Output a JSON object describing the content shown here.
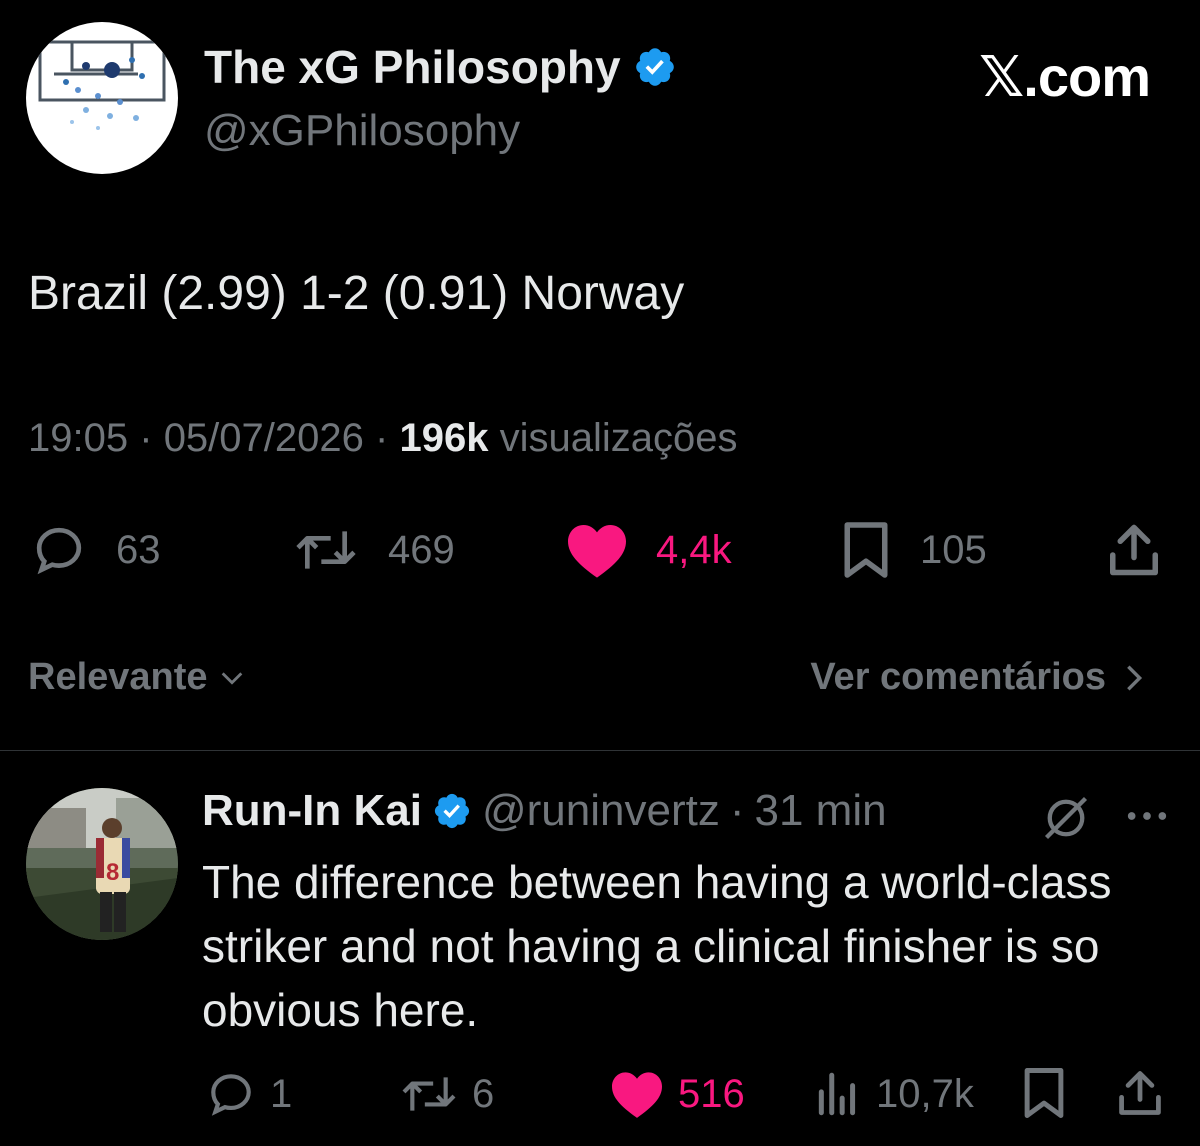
{
  "header": {
    "author_name": "The xG Philosophy",
    "author_handle": "@xGPhilosophy",
    "brand": "𝕏.com",
    "verified": true
  },
  "tweet": {
    "text": "Brazil (2.99) 1-2 (0.91) Norway",
    "time": "19:05",
    "date": "05/07/2026",
    "views_count": "196k",
    "views_label": "visualizações",
    "separator": "·"
  },
  "actions": {
    "replies": "63",
    "retweets": "469",
    "likes": "4,4k",
    "bookmarks": "105"
  },
  "sort": {
    "label": "Relevante",
    "view_comments": "Ver comentários"
  },
  "reply": {
    "name": "Run-In Kai",
    "handle": "@runinvertz",
    "separator": "·",
    "time": "31 min",
    "text": "The difference between having a world-class striker and not having a clinical finisher is so obvious here.",
    "replies": "1",
    "retweets": "6",
    "likes": "516",
    "views": "10,7k",
    "jersey_number": "8"
  },
  "colors": {
    "background": "#000000",
    "text": "#e7e9ea",
    "muted": "#71767b",
    "like": "#f91880",
    "verified": "#1d9bf0",
    "divider": "#2f3336"
  },
  "icons": [
    "reply-icon",
    "retweet-icon",
    "heart-icon",
    "bookmark-icon",
    "share-icon",
    "verified-badge-icon",
    "chevron-down-icon",
    "chevron-right-icon",
    "grok-icon",
    "more-icon",
    "views-icon"
  ]
}
